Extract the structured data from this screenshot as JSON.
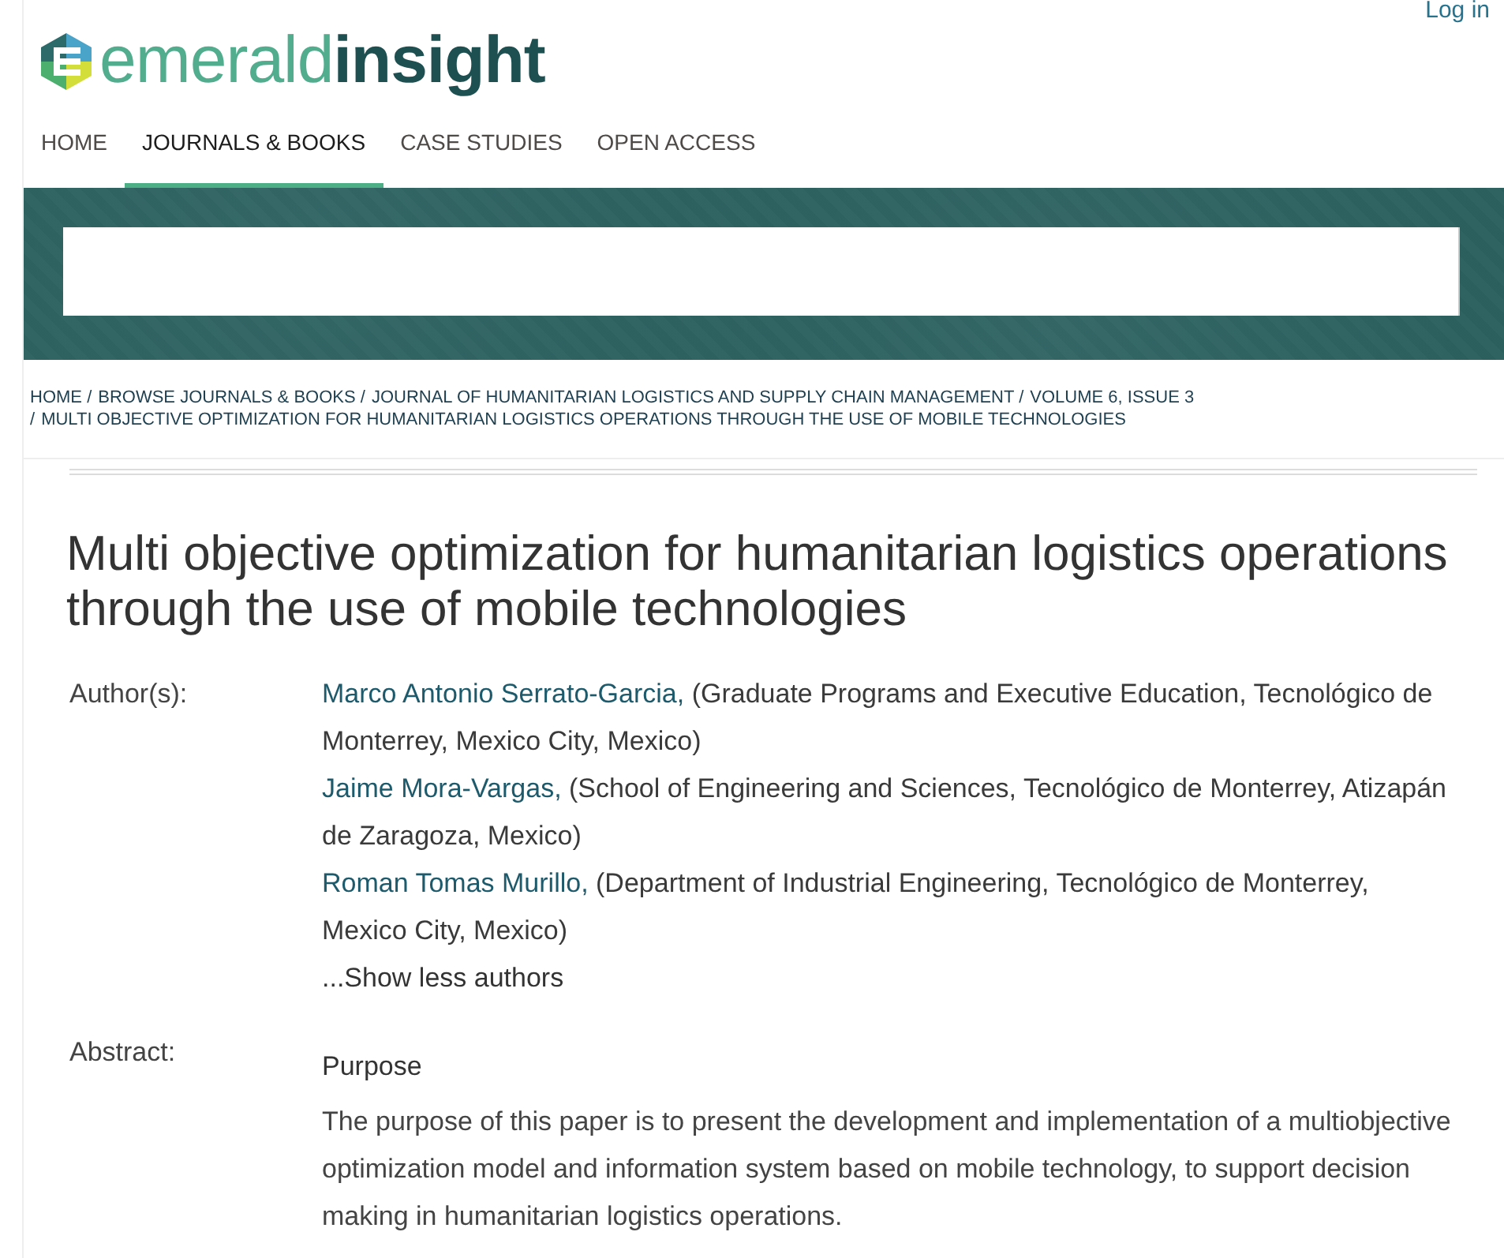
{
  "header": {
    "login": "Log in",
    "logo": "emerald**insight**"
  },
  "nav": {
    "tabs": [
      {
        "label": "HOME",
        "selected": false
      },
      {
        "label": "JOURNALS & BOOKS",
        "selected": true
      },
      {
        "label": "CASE STUDIES",
        "selected": false
      },
      {
        "label": "OPEN ACCESS",
        "selected": false
      }
    ]
  },
  "breadcrumb": {
    "items": [
      {
        "label": "HOME"
      },
      {
        "separator": "/",
        "label": "BROWSE JOURNALS & BOOKS"
      },
      {
        "separator": "/",
        "label": "JOURNAL OF HUMANITARIAN LOGISTICS AND SUPPLY CHAIN MANAGEMENT"
      },
      {
        "separator": "/",
        "label": "VOLUME 6, ISSUE 3"
      },
      {
        "separator": "/",
        "label": "MULTI OBJECTIVE OPTIMIZATION FOR HUMANITARIAN LOGISTICS OPERATIONS THROUGH THE USE OF MOBILE TECHNOLOGIES"
      }
    ]
  },
  "article": {
    "title": "Multi objective optimization for humanitarian logistics operations through the use of mobile technologies",
    "authors_label": "Author(s):",
    "authors": [
      {
        "name": "Marco Antonio Serrato-Garcia,",
        "affiliation": "(Graduate Programs and Executive Education, Tecnológico de Monterrey, Mexico City, Mexico)"
      },
      {
        "name": "Jaime Mora-Vargas,",
        "affiliation": "(School of Engineering and Sciences, Tecnológico de Monterrey, Atizapán de Zaragoza, Mexico)"
      },
      {
        "name": "Roman Tomas Murillo,",
        "affiliation": "(Department of Industrial Engineering, Tecnológico de Monterrey, Mexico City, Mexico)"
      }
    ],
    "show_less": "...Show less authors",
    "abstract_label": "Abstract:",
    "abstract": {
      "heading": "Purpose",
      "text": "The purpose of this paper is to present the development and implementation of a multiobjective optimization model and information system based on mobile technology, to support decision making in humanitarian logistics operations."
    }
  }
}
